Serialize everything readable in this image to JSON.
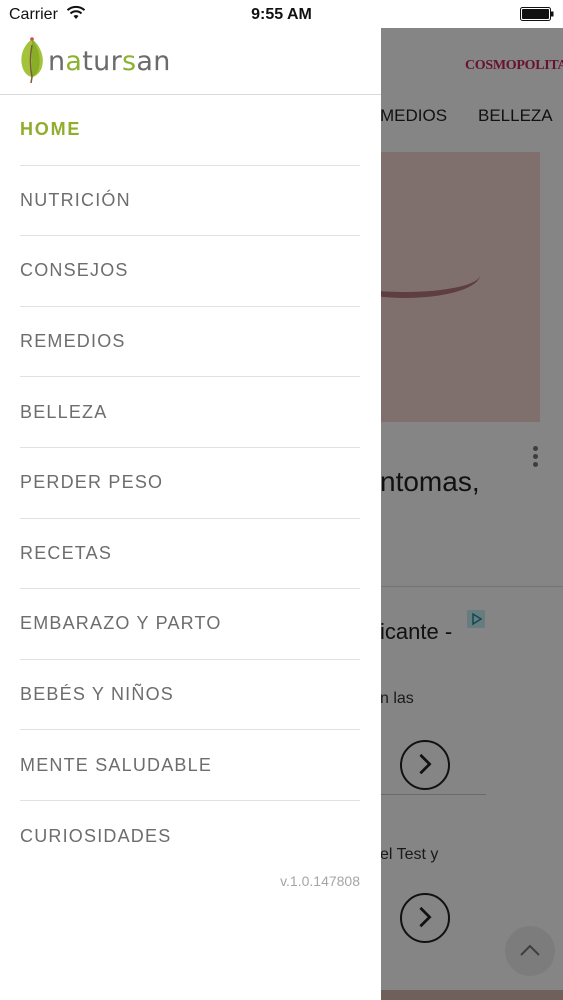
{
  "status_bar": {
    "carrier": "Carrier",
    "time": "9:55 AM"
  },
  "drawer": {
    "logo": {
      "text_prefix": "n",
      "text_accent_a": "a",
      "text_mid": "tur",
      "text_accent_s": "s",
      "text_suffix": "an",
      "brand": "natursan"
    },
    "menu": [
      {
        "label": "HOME",
        "active": true
      },
      {
        "label": "NUTRICIÓN",
        "active": false
      },
      {
        "label": "CONSEJOS",
        "active": false
      },
      {
        "label": "REMEDIOS",
        "active": false
      },
      {
        "label": "BELLEZA",
        "active": false
      },
      {
        "label": "PERDER PESO",
        "active": false
      },
      {
        "label": "RECETAS",
        "active": false
      },
      {
        "label": "EMBARAZO Y PARTO",
        "active": false
      },
      {
        "label": "BEBÉS Y NIÑOS",
        "active": false
      },
      {
        "label": "MENTE SALUDABLE",
        "active": false
      },
      {
        "label": "CURIOSIDADES",
        "active": false
      }
    ],
    "version": "v.1.0.147808"
  },
  "background": {
    "brand": "COSMOPOLITAN",
    "tabs": [
      "MEDIOS",
      "BELLEZA"
    ],
    "headline_fragment": "ntomas,",
    "ad_title_fragment": "icante -",
    "ad_text_1": "n las",
    "ad_text_2": "el Test y"
  },
  "colors": {
    "accent_green": "#8fae2b",
    "menu_text": "#6d6d6d",
    "brand_pink": "#c8235a"
  }
}
